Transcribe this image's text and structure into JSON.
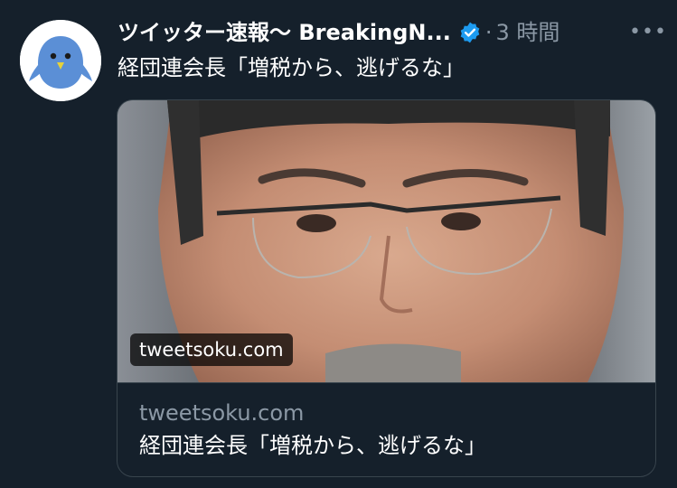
{
  "tweet": {
    "display_name": "ツイッター速報〜 BreakingN...",
    "separator": "·",
    "timestamp": "3 時間",
    "more_label": "•••",
    "text": "経団連会長「増税から、逃げるな」",
    "avatar_icon": "bluebird-avatar-icon",
    "verified_icon": "verified-badge-icon"
  },
  "card": {
    "image_domain_label": "tweetsoku.com",
    "domain": "tweetsoku.com",
    "title": "経団連会長「増税から、逃げるな」"
  },
  "colors": {
    "background": "#15202b",
    "text_primary": "#ffffff",
    "text_secondary": "#8b98a5",
    "border": "#38444d",
    "verified": "#1d9bf0",
    "avatar_bird": "#5b8fd6"
  }
}
